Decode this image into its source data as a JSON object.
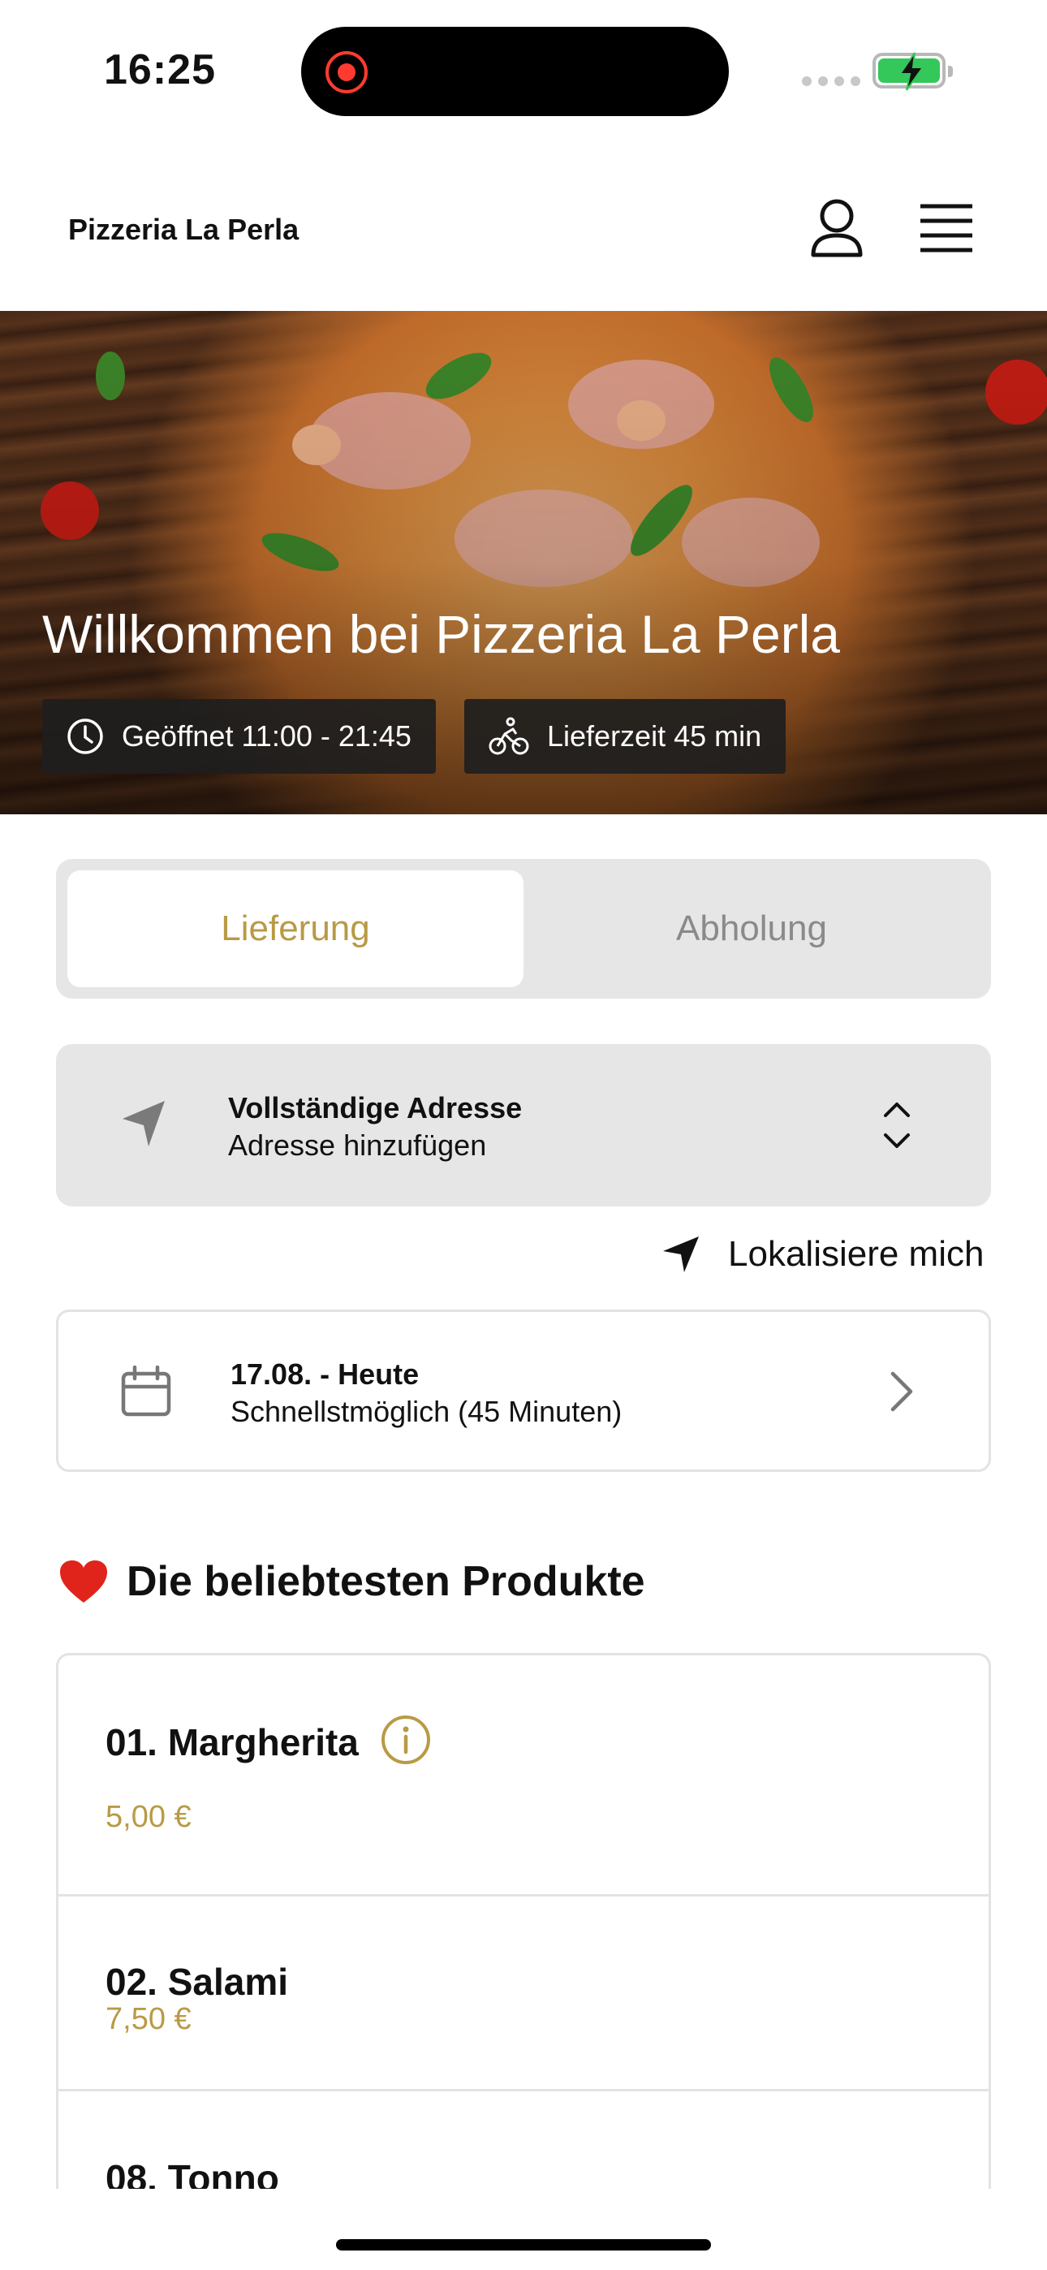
{
  "status_bar": {
    "time": "16:25"
  },
  "header": {
    "brand": "Pizzeria La Perla"
  },
  "hero": {
    "title": "Willkommen bei Pizzeria La Perla",
    "opening_hours": "Geöffnet 11:00 - 21:45",
    "delivery_time": "Lieferzeit 45 min"
  },
  "mode_toggle": {
    "delivery_label": "Lieferung",
    "pickup_label": "Abholung",
    "selected": "Lieferung"
  },
  "address": {
    "title": "Vollständige Adresse",
    "subtitle": "Adresse hinzufügen"
  },
  "locate_label": "Lokalisiere mich",
  "schedule": {
    "date": "17.08. - Heute",
    "time": "Schnellstmöglich (45 Minuten)"
  },
  "popular": {
    "title": "Die beliebtesten Produkte",
    "items": [
      {
        "name": "01. Margherita",
        "price": "5,00 €"
      },
      {
        "name": "02. Salami",
        "price": "7,50 €"
      },
      {
        "name": "08. Tonno"
      }
    ]
  },
  "colors": {
    "accent": "#b99a45",
    "surface": "#e6e6e6",
    "battery": "#34c759",
    "recording": "#ff3b30"
  },
  "icons": [
    "user-icon",
    "menu-icon",
    "clock-icon",
    "bike-icon",
    "navigation-arrow-icon",
    "chevron-up-down-icon",
    "calendar-icon",
    "chevron-right-icon",
    "heart-icon",
    "info-icon"
  ]
}
